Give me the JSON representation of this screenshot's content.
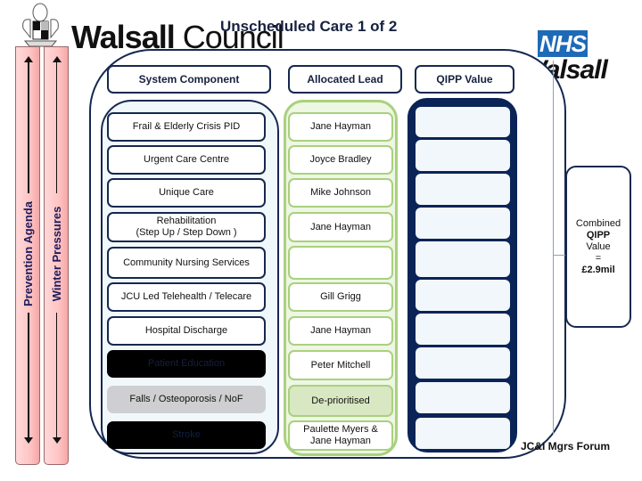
{
  "header": {
    "council_logo_bold": "Walsall",
    "council_logo_light": "Council",
    "title": "Unscheduled Care 1 of 2",
    "nhs_badge": "NHS",
    "nhs_org": "Walsall"
  },
  "sidebars": [
    {
      "label": "Prevention Agenda"
    },
    {
      "label": "Winter Pressures"
    }
  ],
  "columns": {
    "system_component": "System Component",
    "allocated_lead": "Allocated Lead",
    "qipp_value": "QIPP Value"
  },
  "rows": [
    {
      "component": "Frail & Elderly Crisis PID",
      "lead": "Jane Hayman",
      "status": "normal"
    },
    {
      "component": "Urgent Care Centre",
      "lead": "Joyce Bradley",
      "status": "normal"
    },
    {
      "component": "Unique Care",
      "lead": "Mike Johnson",
      "status": "normal"
    },
    {
      "component": "Rehabilitation\n(Step Up / Step Down )",
      "lead": "Jane Hayman",
      "status": "normal"
    },
    {
      "component": "Community Nursing Services",
      "lead": "",
      "status": "normal"
    },
    {
      "component": "JCU Led Telehealth / Telecare",
      "lead": "Gill Grigg",
      "status": "normal"
    },
    {
      "component": "Hospital Discharge",
      "lead": "Jane Hayman",
      "status": "normal"
    },
    {
      "component": "Patient Education",
      "lead": "Peter Mitchell",
      "status": "blacked-out"
    },
    {
      "component": "Falls / Osteoporosis / NoF",
      "lead": "De-prioritised",
      "status": "de-prioritised"
    },
    {
      "component": "Stroke",
      "lead": "Paulette Myers &\nJane Hayman",
      "status": "blacked-out"
    }
  ],
  "combined": {
    "line1": "Combined",
    "line2": "QIPP",
    "line3": "Value",
    "line4": "=",
    "line5": "£2.9mil"
  },
  "footer": "JC&I Mgrs Forum",
  "colors": {
    "navy": "#16284f",
    "qipp_navy": "#0a2458",
    "lead_green": "#a9d17e",
    "deprioritised_fill": "#d8e8c2",
    "sidebar_pink": "#ffc4c4",
    "nhs_blue": "#1e6ab7"
  }
}
